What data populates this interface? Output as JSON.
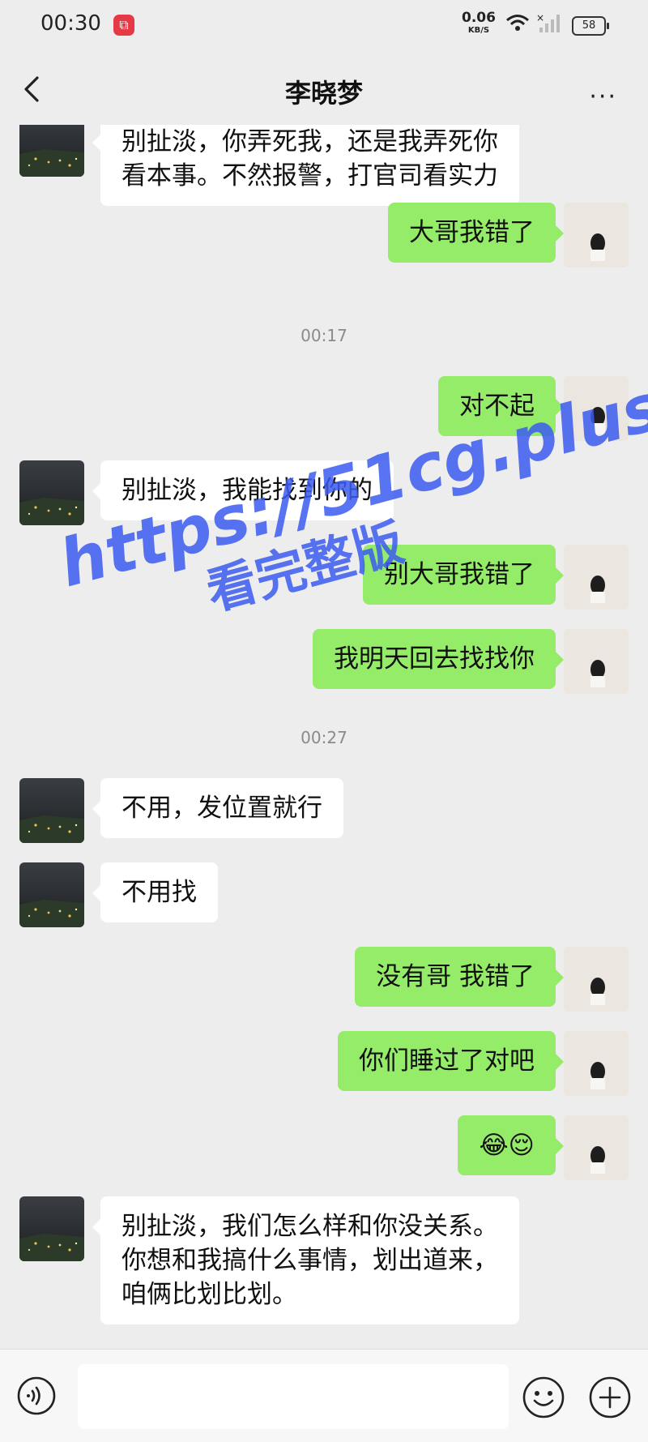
{
  "status_bar": {
    "time": "00:30",
    "net_speed": "0.06",
    "net_unit": "KB/S",
    "battery": "58"
  },
  "header": {
    "title": "李晓梦",
    "more": "···"
  },
  "messages": [
    {
      "side": "in",
      "lines": [
        "别扯淡，你弄死我，还是我弄死你",
        "看本事。不然报警，打官司看实力"
      ]
    },
    {
      "side": "out",
      "text": "大哥我错了"
    },
    {
      "type": "time",
      "text": "00:17"
    },
    {
      "side": "out",
      "text": "对不起"
    },
    {
      "side": "in",
      "text": "别扯淡，我能找到你的"
    },
    {
      "side": "out",
      "text": "别大哥我错了"
    },
    {
      "side": "out",
      "text": "我明天回去找找你"
    },
    {
      "type": "time",
      "text": "00:27"
    },
    {
      "side": "in",
      "text": "不用，发位置就行"
    },
    {
      "side": "in",
      "text": "不用找"
    },
    {
      "side": "out",
      "text": "没有哥 我错了"
    },
    {
      "side": "out",
      "text": "你们睡过了对吧"
    },
    {
      "side": "out",
      "emojis": "😂😌"
    },
    {
      "side": "in",
      "lines": [
        "别扯淡，我们怎么样和你没关系。",
        "你想和我搞什么事情，划出道来，",
        "咱俩比划比划。"
      ]
    }
  ],
  "watermark": {
    "line1": "https://51cg.plus",
    "line2": "看完整版"
  },
  "input_bar": {
    "placeholder": ""
  },
  "icons": [
    "back-arrow-icon",
    "more-icon",
    "wifi-icon",
    "signal-icon",
    "battery-icon",
    "voice-icon",
    "emoji-icon",
    "plus-icon"
  ]
}
